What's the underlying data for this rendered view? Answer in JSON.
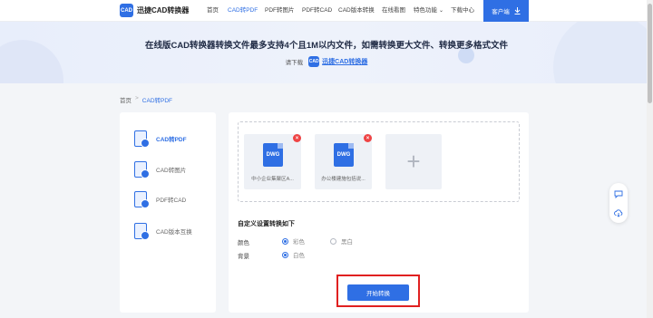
{
  "header": {
    "logo_badge": "CAD",
    "logo_text": "迅捷CAD转换器",
    "nav": [
      {
        "label": "首页"
      },
      {
        "label": "CAD转PDF"
      },
      {
        "label": "PDF转图片"
      },
      {
        "label": "PDF转CAD"
      },
      {
        "label": "CAD版本转换"
      },
      {
        "label": "在线看图"
      },
      {
        "label": "特色功能"
      },
      {
        "label": "下载中心"
      }
    ],
    "client_label": "客户端"
  },
  "banner": {
    "title": "在线版CAD转换器转换文件最多支持4个且1M以内文件，如需转换更大文件、转换更多格式文件",
    "sub_prefix": "请下载",
    "download_label": "迅捷CAD转换器"
  },
  "breadcrumb": {
    "home": "首页",
    "sep": ">",
    "current": "CAD转PDF"
  },
  "sidebar": {
    "items": [
      {
        "label": "CAD转PDF"
      },
      {
        "label": "CAD转图片"
      },
      {
        "label": "PDF转CAD"
      },
      {
        "label": "CAD版本互换"
      }
    ]
  },
  "files": [
    {
      "type": "DWG",
      "name": "中小企业集聚区A..."
    },
    {
      "type": "DWG",
      "name": "办公楼建施包括说..."
    }
  ],
  "settings": {
    "title": "自定义设置转换如下",
    "color_label": "颜色",
    "color_options": [
      "彩色",
      "黑白"
    ],
    "color_selected": "彩色",
    "bg_label": "背景",
    "bg_options": [
      "白色"
    ],
    "bg_selected": "白色"
  },
  "start_label": "开始转换",
  "colors": {
    "accent": "#2f6fe4",
    "highlight": "#e02020",
    "delete": "#ef4444"
  }
}
